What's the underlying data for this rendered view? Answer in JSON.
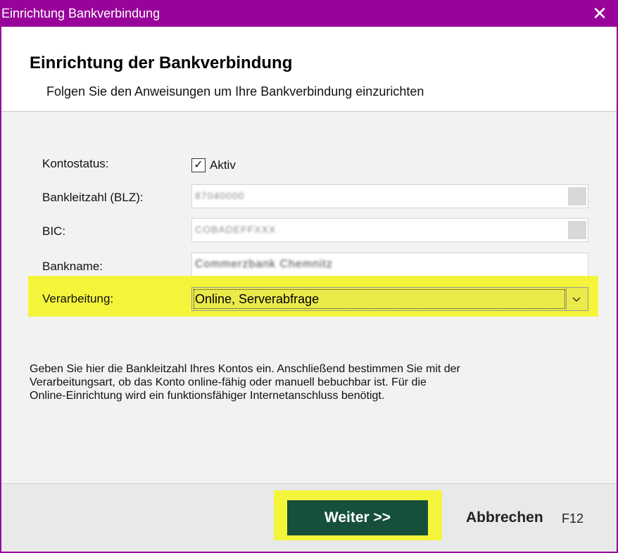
{
  "window": {
    "title": "Einrichtung Bankverbindung",
    "close_glyph": "✕",
    "accent_color": "#98049a"
  },
  "header": {
    "title": "Einrichtung der Bankverbindung",
    "subtitle": "Folgen Sie den Anweisungen um Ihre Bankverbindung einzurichten"
  },
  "form": {
    "kontostatus_label": "Kontostatus:",
    "kontostatus_checkbox_label": "Aktiv",
    "kontostatus_checked": true,
    "blz_label": "Bankleitzahl (BLZ):",
    "blz_value": "87040000",
    "bic_label": "BIC:",
    "bic_value": "COBADEFFXXX",
    "bankname_label": "Bankname:",
    "bankname_value": "Commerzbank Chemnitz",
    "verarbeitung_label": "Verarbeitung:",
    "verarbeitung_value": "Online, Serverabfrage",
    "highlight_color": "#f4f53a"
  },
  "help_text": {
    "line1": "Geben Sie hier die Bankleitzahl Ihres Kontos ein. Anschließend bestimmen Sie mit der",
    "line2": "Verarbeitungsart, ob das Konto online-fähig oder manuell bebuchbar ist. Für die",
    "line3": "Online-Einrichtung wird ein funktionsfähiger Internetanschluss benötigt."
  },
  "footer": {
    "next_label": "Weiter >>",
    "cancel_label": "Abbrechen",
    "cancel_shortcut": "F12",
    "next_color": "#16503a"
  }
}
